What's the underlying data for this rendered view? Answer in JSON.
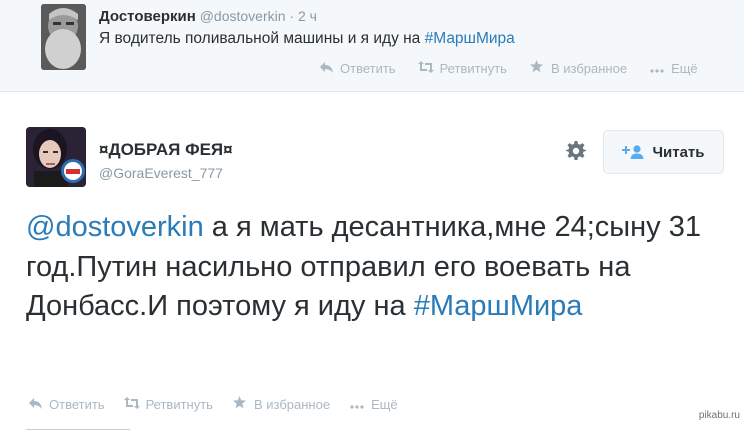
{
  "parent_tweet": {
    "name": "Достоверкин",
    "handle": "@dostoverkin",
    "dot": "·",
    "time": "2 ч",
    "text_prefix": "Я водитель поливальной машины и я иду на ",
    "hashtag": "#МаршМира",
    "actions": {
      "reply": "Ответить",
      "retweet": "Ретвитнуть",
      "favorite": "В избранное",
      "more": "Ещё"
    }
  },
  "main_tweet": {
    "name": "¤ДОБРАЯ ФЕЯ¤",
    "handle": "@GoraEverest_777",
    "follow_label": "Читать",
    "mention": "@dostoverkin",
    "text_body": " а я мать десантника,мне 24;сыну 31 год.Путин насильно отправил его воевать на Донбасс.И поэтому я иду на ",
    "hashtag": "#МаршМира",
    "actions": {
      "reply": "Ответить",
      "retweet": "Ретвитнуть",
      "favorite": "В избранное",
      "more": "Ещё"
    }
  },
  "watermark": "pikabu.ru",
  "colors": {
    "link": "#2b7bb9",
    "muted": "#8899a6",
    "action": "#aab8c2",
    "text": "#292f33"
  }
}
